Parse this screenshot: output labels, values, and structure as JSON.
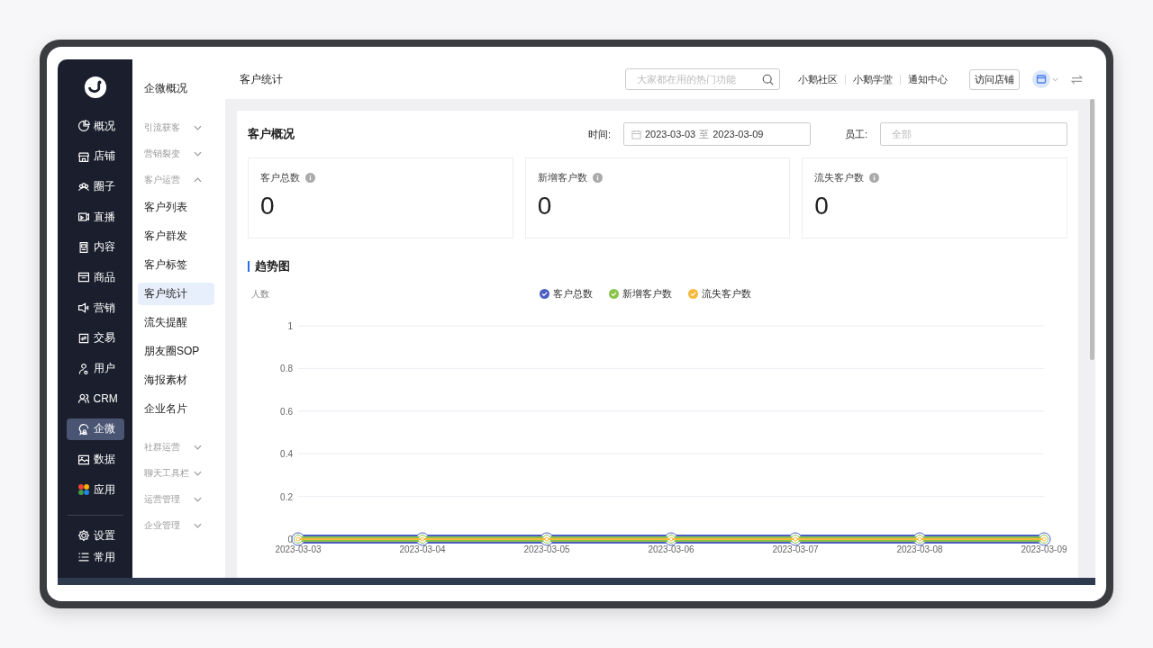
{
  "nav": {
    "items": [
      {
        "label": "概况",
        "selected": false
      },
      {
        "label": "店铺",
        "selected": false
      },
      {
        "label": "圈子",
        "selected": false
      },
      {
        "label": "直播",
        "selected": false
      },
      {
        "label": "内容",
        "selected": false
      },
      {
        "label": "商品",
        "selected": false
      },
      {
        "label": "营销",
        "selected": false
      },
      {
        "label": "交易",
        "selected": false
      },
      {
        "label": "用户",
        "selected": false
      },
      {
        "label": "CRM",
        "selected": false
      },
      {
        "label": "企微",
        "selected": true
      },
      {
        "label": "数据",
        "selected": false
      },
      {
        "label": "应用",
        "selected": false
      }
    ],
    "bottom_items": [
      {
        "label": "设置"
      },
      {
        "label": "常用"
      }
    ]
  },
  "submenu": [
    {
      "kind": "link",
      "label": "企微概况",
      "selected": false
    },
    {
      "kind": "group",
      "label": "引流获客",
      "expanded": false
    },
    {
      "kind": "group",
      "label": "营销裂变",
      "expanded": false
    },
    {
      "kind": "group",
      "label": "客户运营",
      "expanded": true
    },
    {
      "kind": "link",
      "label": "客户列表",
      "selected": false
    },
    {
      "kind": "link",
      "label": "客户群发",
      "selected": false
    },
    {
      "kind": "link",
      "label": "客户标签",
      "selected": false
    },
    {
      "kind": "link",
      "label": "客户统计",
      "selected": true
    },
    {
      "kind": "link",
      "label": "流失提醒",
      "selected": false
    },
    {
      "kind": "link",
      "label": "朋友圈SOP",
      "selected": false
    },
    {
      "kind": "link",
      "label": "海报素材",
      "selected": false
    },
    {
      "kind": "link",
      "label": "企业名片",
      "selected": false
    },
    {
      "kind": "group",
      "label": "社群运营",
      "expanded": false
    },
    {
      "kind": "group",
      "label": "聊天工具栏",
      "expanded": false
    },
    {
      "kind": "group",
      "label": "运营管理",
      "expanded": false
    },
    {
      "kind": "group",
      "label": "企业管理",
      "expanded": false
    }
  ],
  "header": {
    "title": "客户统计",
    "search": {
      "placeholder": "大家都在用的热门功能"
    },
    "links": [
      "小鹅社区",
      "小鹅学堂",
      "通知中心"
    ],
    "visit_button": "访问店铺"
  },
  "overview": {
    "title": "客户概况",
    "time_label": "时间:",
    "date_start": "2023-03-03",
    "date_separator": "至",
    "date_end": "2023-03-09",
    "staff_label": "员工:",
    "staff_field": {
      "placeholder": "全部"
    }
  },
  "stats": [
    {
      "label": "客户总数",
      "value": "0"
    },
    {
      "label": "新增客户数",
      "value": "0"
    },
    {
      "label": "流失客户数",
      "value": "0"
    }
  ],
  "trend": {
    "title": "趋势图",
    "chart_data": {
      "type": "line",
      "ylabel": "人数",
      "categories": [
        "2023-03-03",
        "2023-03-04",
        "2023-03-05",
        "2023-03-06",
        "2023-03-07",
        "2023-03-08",
        "2023-03-09"
      ],
      "series": [
        {
          "name": "客户总数",
          "color": "#4a5fc1",
          "marker": "circle",
          "values": [
            0,
            0,
            0,
            0,
            0,
            0,
            0
          ]
        },
        {
          "name": "新增客户数",
          "color": "#8bc34a",
          "marker": "circle",
          "values": [
            0,
            0,
            0,
            0,
            0,
            0,
            0
          ]
        },
        {
          "name": "流失客户数",
          "color": "#f6b93b",
          "marker": "circle",
          "values": [
            0,
            0,
            0,
            0,
            0,
            0,
            0
          ]
        }
      ],
      "grid": true,
      "ylim": [
        0,
        1
      ],
      "yticks": [
        0,
        0.2,
        0.4,
        0.6,
        0.8,
        1
      ]
    }
  }
}
